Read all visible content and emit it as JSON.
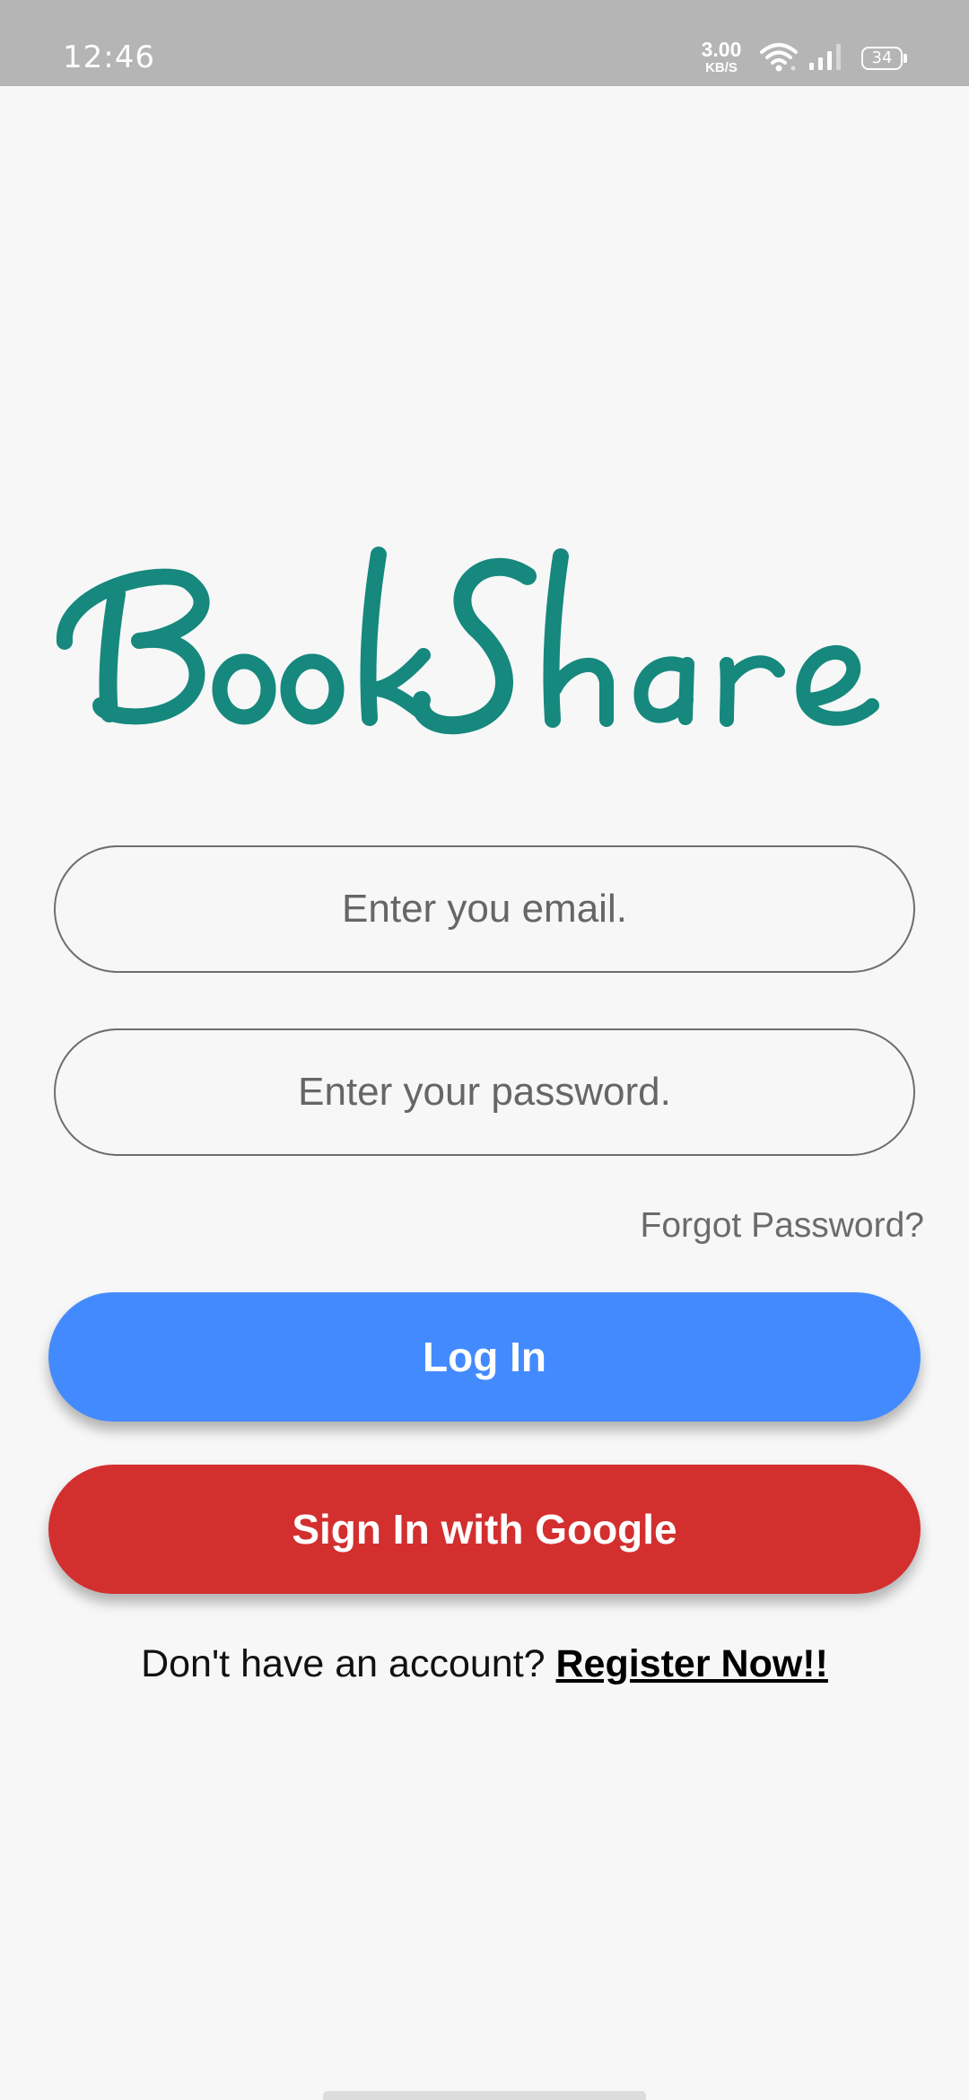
{
  "status_bar": {
    "time": "12:46",
    "net_speed_value": "3.00",
    "net_speed_unit": "KB/S",
    "battery": "34"
  },
  "logo": {
    "text": "BookShare",
    "color": "#16887e"
  },
  "form": {
    "email_placeholder": "Enter you email.",
    "password_placeholder": "Enter your password.",
    "forgot_password": "Forgot Password?"
  },
  "buttons": {
    "login_label": "Log In",
    "login_color": "#448aff",
    "google_label": "Sign In with Google",
    "google_color": "#d32f2f"
  },
  "register": {
    "prompt": "Don't have an account? ",
    "link": "Register Now!!"
  }
}
